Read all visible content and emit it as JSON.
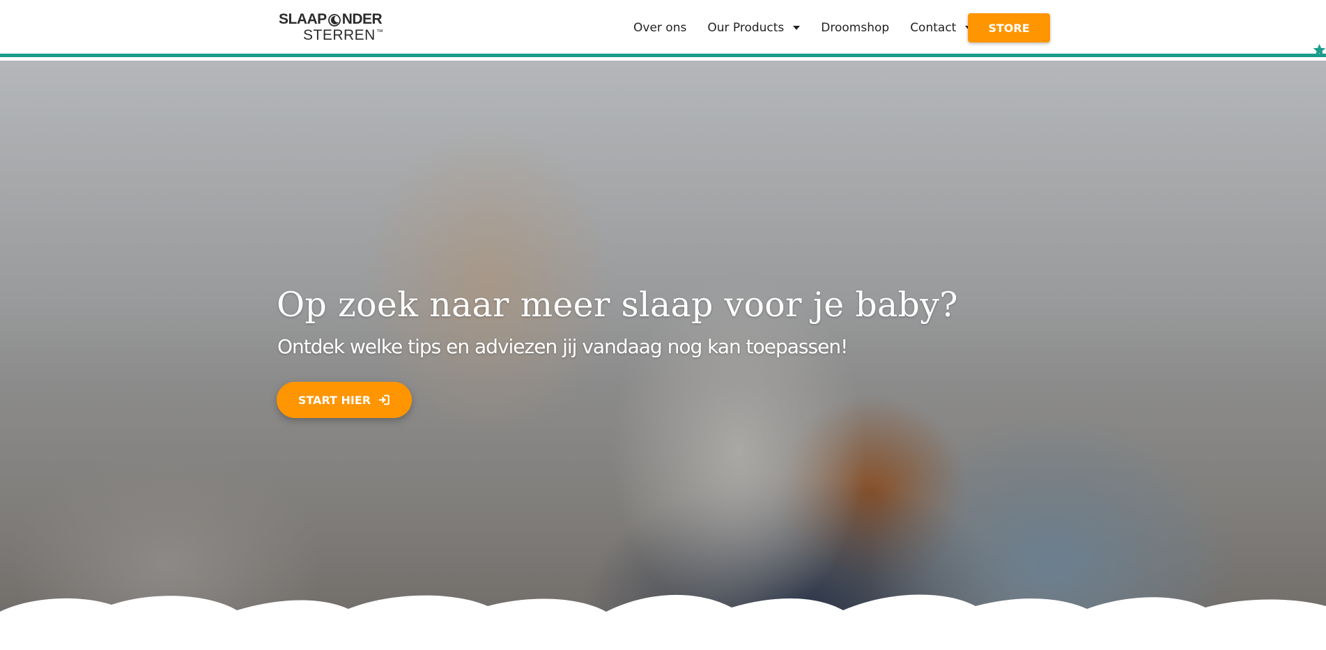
{
  "brand": {
    "line1_left": "SLAAP",
    "line1_right": "NDER",
    "line2": "STERREN",
    "trademark": "™"
  },
  "nav": {
    "items": [
      {
        "label": "Over ons",
        "has_dropdown": false
      },
      {
        "label": "Our Products",
        "has_dropdown": true
      },
      {
        "label": "Droomshop",
        "has_dropdown": false
      },
      {
        "label": "Contact",
        "has_dropdown": true
      }
    ],
    "store_label": "STORE"
  },
  "hero": {
    "title": "Op zoek naar meer slaap voor je baby?",
    "subtitle": "Ontdek welke tips en adviezen jij vandaag nog kan toepassen!",
    "cta_label": "START HIER",
    "cta_icon": "sign-in-icon"
  },
  "icons": {
    "star": "star-icon",
    "logo_moon": "moon-icon"
  },
  "colors": {
    "accent": "#ff9500",
    "header_border": "#1a9c8c",
    "text_dark": "#222222",
    "white": "#ffffff"
  }
}
